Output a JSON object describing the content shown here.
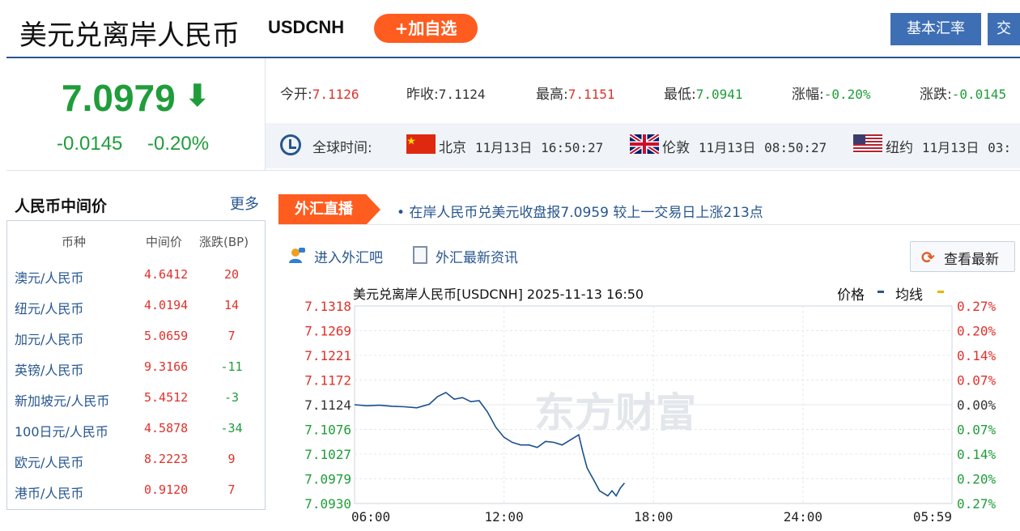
{
  "header": {
    "title": "美元兑离岸人民币",
    "code": "USDCNH",
    "add_button": "+加自选",
    "nav": [
      "基本汇率",
      "交"
    ]
  },
  "quote": {
    "price": "7.0979",
    "arrow": "down-arrow",
    "change": "-0.0145",
    "change_pct": "-0.20%",
    "stats": [
      {
        "label": "今开:",
        "value": "7.1126",
        "color": "#e0312b"
      },
      {
        "label": "昨收:",
        "value": "7.1124",
        "color": "#333333"
      },
      {
        "label": "最高:",
        "value": "7.1151",
        "color": "#e0312b"
      },
      {
        "label": "最低:",
        "value": "7.0941",
        "color": "#1f9d3a"
      },
      {
        "label": "涨幅:",
        "value": "-0.20%",
        "color": "#1f9d3a"
      },
      {
        "label": "涨跌:",
        "value": "-0.0145",
        "color": "#1f9d3a"
      }
    ]
  },
  "global_time": {
    "label": "全球时间:",
    "cities": [
      {
        "flag": "china-flag",
        "city": "北京",
        "date": "11月13日",
        "time": "16:50:27"
      },
      {
        "flag": "uk-flag",
        "city": "伦敦",
        "date": "11月13日",
        "time": "08:50:27"
      },
      {
        "flag": "us-flag",
        "city": "纽约",
        "date": "11月13日",
        "time": "03:"
      }
    ]
  },
  "cny_mid": {
    "title": "人民币中间价",
    "more": "更多",
    "headers": [
      "币种",
      "中间价",
      "涨跌(BP)"
    ],
    "rows": [
      {
        "name": "澳元/人民币",
        "value": "4.6412",
        "bp": "20"
      },
      {
        "name": "纽元/人民币",
        "value": "4.0194",
        "bp": "14"
      },
      {
        "name": "加元/人民币",
        "value": "5.0659",
        "bp": "7"
      },
      {
        "name": "英镑/人民币",
        "value": "9.3166",
        "bp": "-11"
      },
      {
        "name": "新加坡元/人民币",
        "value": "5.4512",
        "bp": "-3"
      },
      {
        "name": "100日元/人民币",
        "value": "4.5878",
        "bp": "-34"
      },
      {
        "name": "欧元/人民币",
        "value": "8.2223",
        "bp": "9"
      },
      {
        "name": "港币/人民币",
        "value": "0.9120",
        "bp": "7"
      }
    ]
  },
  "live": {
    "tab": "外汇直播",
    "headline": "• 在岸人民币兑美元收盘报7.0959 较上一交易日上涨213点"
  },
  "links": {
    "forum": "进入外汇吧",
    "news": "外汇最新资讯",
    "refresh": "查看最新"
  },
  "colors": {
    "up": "#e0312b",
    "down": "#1f9d3a",
    "brand": "#27568f",
    "accent": "#ff5c1f"
  },
  "chart_data": {
    "type": "line",
    "title": "美元兑离岸人民币[USDCNH] 2025-11-13 16:50",
    "legend": [
      "价格",
      "均线"
    ],
    "watermark": "东方财富",
    "y_ticks": [
      "7.1318",
      "7.1269",
      "7.1221",
      "7.1172",
      "7.1124",
      "7.1076",
      "7.1027",
      "7.0979",
      "7.0930"
    ],
    "y_right_ticks": [
      "0.27%",
      "0.20%",
      "0.14%",
      "0.07%",
      "0.00%",
      "0.07%",
      "0.14%",
      "0.20%",
      "0.27%"
    ],
    "x_ticks": [
      "06:00",
      "12:00",
      "18:00",
      "24:00",
      "05:59"
    ],
    "ylim": [
      7.093,
      7.1318
    ],
    "prev_close": 7.1124,
    "series": [
      {
        "name": "价格",
        "x": [
          "06:00",
          "06:30",
          "07:00",
          "07:30",
          "08:00",
          "08:30",
          "09:00",
          "09:20",
          "09:40",
          "10:00",
          "10:20",
          "10:40",
          "11:00",
          "11:20",
          "11:40",
          "12:00",
          "12:20",
          "12:40",
          "13:00",
          "13:20",
          "13:40",
          "14:00",
          "14:20",
          "14:40",
          "15:00",
          "15:10",
          "15:20",
          "15:30",
          "15:40",
          "15:50",
          "16:00",
          "16:10",
          "16:20",
          "16:30",
          "16:40",
          "16:50"
        ],
        "values": [
          7.1124,
          7.1122,
          7.1123,
          7.1121,
          7.112,
          7.1118,
          7.1125,
          7.114,
          7.1148,
          7.1135,
          7.1138,
          7.113,
          7.1132,
          7.111,
          7.108,
          7.106,
          7.105,
          7.1045,
          7.1045,
          7.104,
          7.1052,
          7.105,
          7.1045,
          7.1055,
          7.1065,
          7.103,
          7.1,
          7.0985,
          7.097,
          7.0955,
          7.095,
          7.0945,
          7.0955,
          7.0945,
          7.096,
          7.097
        ]
      }
    ]
  }
}
